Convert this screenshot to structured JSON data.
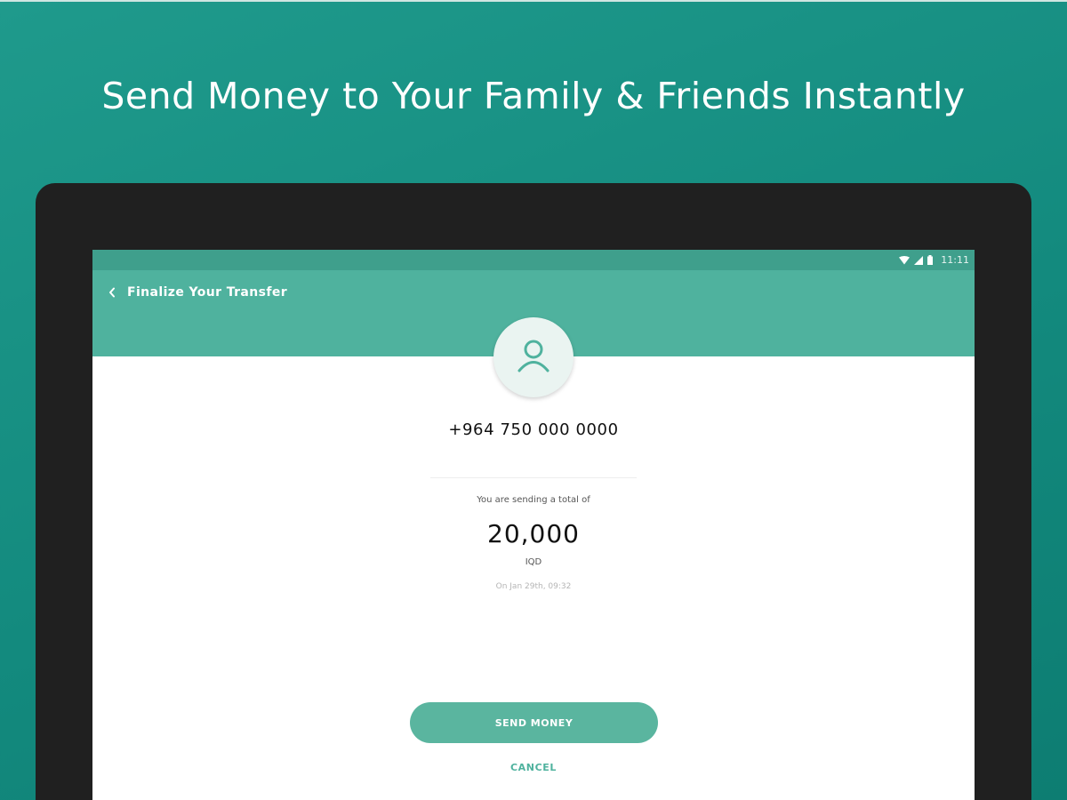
{
  "headline": "Send Money to Your Family & Friends Instantly",
  "status_bar": {
    "time": "11:11",
    "icons": [
      "wifi-icon",
      "signal-icon",
      "battery-icon"
    ]
  },
  "app_bar": {
    "title": "Finalize Your Transfer",
    "back_icon": "chevron-left-icon"
  },
  "recipient": {
    "avatar_icon": "user-icon",
    "phone": "+964 750 000 0000"
  },
  "transfer": {
    "label": "You are sending a total of",
    "amount": "20,000",
    "currency": "IQD",
    "date": "On Jan 29th, 09:32"
  },
  "actions": {
    "send_label": "SEND MONEY",
    "cancel_label": "CANCEL"
  },
  "colors": {
    "background": "#178f83",
    "accent": "#4fb29e",
    "status_bar": "#3f9f8c",
    "device_frame": "#202020"
  }
}
